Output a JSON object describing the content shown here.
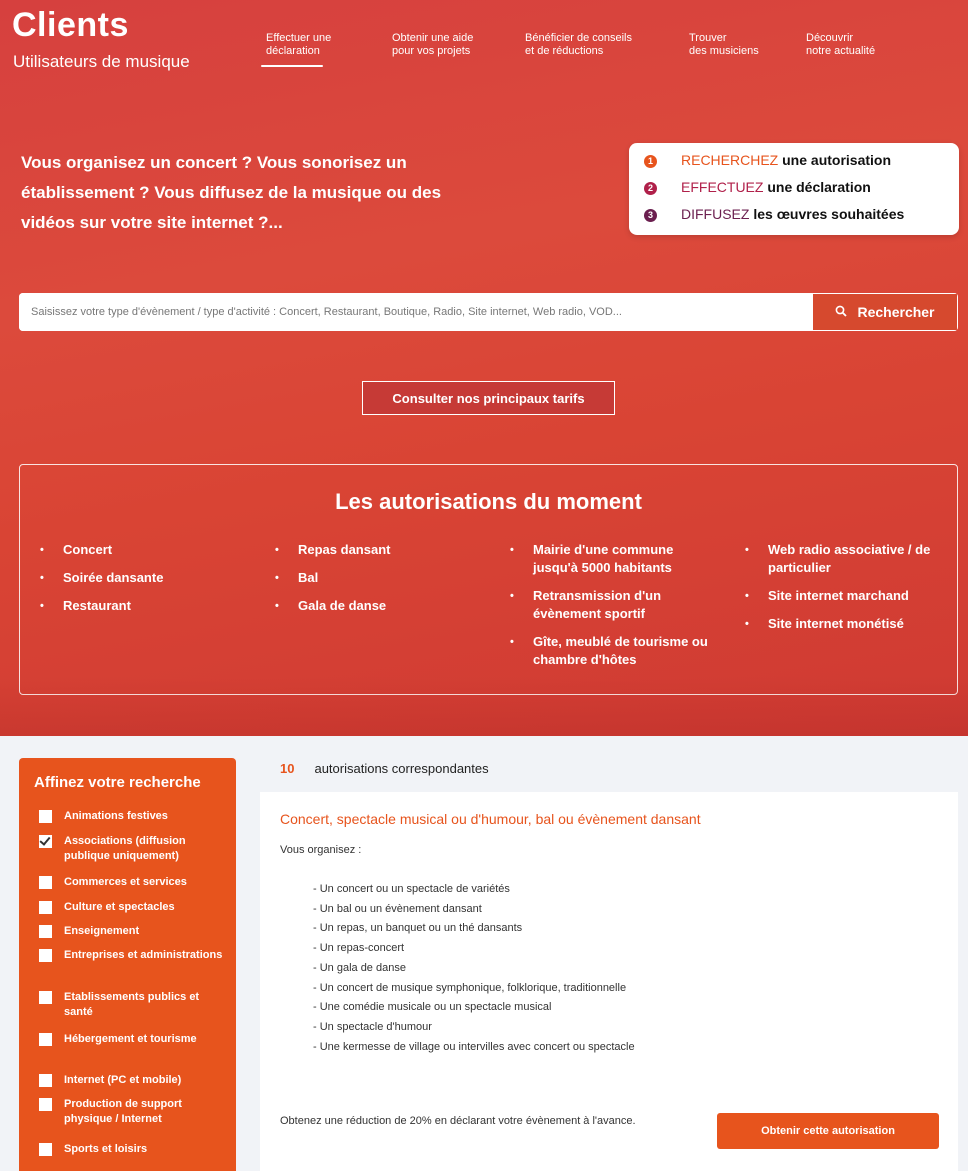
{
  "header": {
    "title": "Clients",
    "subtitle": "Utilisateurs de musique",
    "nav": [
      {
        "line1": "Effectuer une",
        "line2": "déclaration"
      },
      {
        "line1": "Obtenir une aide",
        "line2": "pour vos projets"
      },
      {
        "line1": "Bénéficier de conseils",
        "line2": "et de réductions"
      },
      {
        "line1": "Trouver",
        "line2": "des musiciens"
      },
      {
        "line1": "Découvrir",
        "line2": "notre actualité"
      }
    ]
  },
  "hero": {
    "question": "Vous organisez un concert ? Vous sonorisez un établissement ? Vous diffusez de la musique ou des vidéos sur votre site internet ?...",
    "steps": [
      {
        "num": "1",
        "keyword": "RECHERCHEZ",
        "rest": "une autorisation",
        "color": "#e7541d"
      },
      {
        "num": "2",
        "keyword": "EFFECTUEZ",
        "rest": "une déclaration",
        "color": "#b0204a"
      },
      {
        "num": "3",
        "keyword": "DIFFUSEZ",
        "rest": "les œuvres souhaitées",
        "color": "#6b1f4f"
      }
    ]
  },
  "search": {
    "placeholder": "Saisissez votre type d'évènement / type d'activité : Concert, Restaurant, Boutique, Radio, Site internet, Web radio, VOD...",
    "button_label": "Rechercher"
  },
  "tarifs_button": "Consulter nos principaux tarifs",
  "moment": {
    "title": "Les autorisations du moment",
    "columns": [
      [
        "Concert",
        "Soirée dansante",
        "Restaurant"
      ],
      [
        "Repas dansant",
        "Bal",
        "Gala de danse"
      ],
      [
        "Mairie d'une commune jusqu'à 5000 habitants",
        "Retransmission d'un évènement sportif",
        "Gîte, meublé de tourisme ou chambre d'hôtes"
      ],
      [
        "Web radio associative / de particulier",
        "Site internet marchand",
        "Site internet monétisé"
      ]
    ]
  },
  "sidebar": {
    "title": "Affinez votre recherche",
    "filters": [
      {
        "label": "Animations festives",
        "checked": false
      },
      {
        "label": "Associations (diffusion publique uniquement)",
        "checked": true
      },
      {
        "label": "Commerces et services",
        "checked": false
      },
      {
        "label": "Culture et spectacles",
        "checked": false
      },
      {
        "label": "Enseignement",
        "checked": false
      },
      {
        "label": "Entreprises et administrations",
        "checked": false
      },
      {
        "label": "Etablissements publics et santé",
        "checked": false
      },
      {
        "label": "Hébergement et tourisme",
        "checked": false
      },
      {
        "label": "Internet (PC et mobile)",
        "checked": false
      },
      {
        "label": "Production de support physique / Internet",
        "checked": false
      },
      {
        "label": "Sports et loisirs",
        "checked": false
      }
    ]
  },
  "results": {
    "count": "10",
    "label": "autorisations correspondantes",
    "card": {
      "title": "Concert, spectacle musical ou d'humour, bal ou évènement dansant",
      "intro": "Vous organisez :",
      "items": [
        "- Un concert ou un spectacle de variétés",
        "- Un bal ou un évènement dansant",
        "- Un repas, un banquet ou un thé dansants",
        "- Un repas-concert",
        "- Un gala de danse",
        "- Un concert de musique symphonique, folklorique, traditionnelle",
        "- Une comédie musicale ou un spectacle musical",
        "- Un spectacle d'humour",
        "- Une kermesse de village ou intervilles avec concert ou spectacle"
      ],
      "promo": "Obtenez une réduction de 20% en déclarant votre évènement à l'avance.",
      "cta": "Obtenir cette autorisation"
    }
  },
  "colors": {
    "brand_red": "#d6403e",
    "accent_orange": "#e7541d"
  }
}
